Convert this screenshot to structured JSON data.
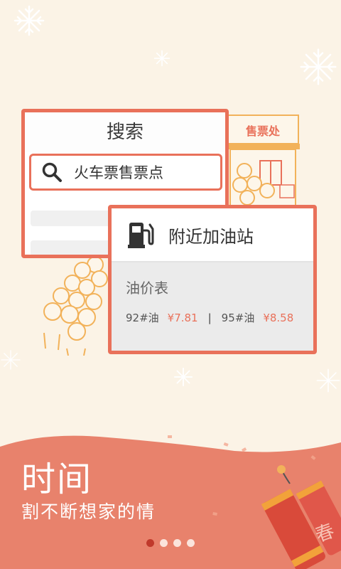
{
  "search_card": {
    "title": "搜索",
    "query": "火车票售票点"
  },
  "station": {
    "sign": "售票处"
  },
  "gas_card": {
    "title": "附近加油站",
    "subtitle": "油价表",
    "prices": [
      {
        "grade": "92#油",
        "price": "¥7.81"
      },
      {
        "grade": "95#油",
        "price": "¥8.58"
      }
    ],
    "separator": "|"
  },
  "banner": {
    "headline": "时间",
    "subline": "割不断想家的情",
    "cracker_text": "春"
  },
  "pager": {
    "count": 4,
    "active_index": 0
  },
  "colors": {
    "accent": "#e9715a",
    "background": "#fbf3e6",
    "banner": "#e8826c",
    "active_dot": "#c0392b"
  },
  "icons": [
    "search-icon",
    "gas-pump-icon",
    "snowflake-icon",
    "firecracker-icon"
  ]
}
